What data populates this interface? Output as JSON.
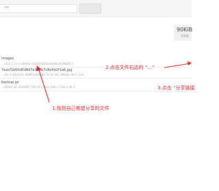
{
  "toolbar": {
    "search_value": "",
    "button_label": "",
    "left_text": "…oo"
  },
  "quota": {
    "size": "90KiB",
    "label": "总容量"
  },
  "items": [
    {
      "name": "images",
      "meta": "…r4e3 2 31 e-a4fe0a e3b2054b4ea0e48c0fa9b66(?)"
    },
    {
      "name": "7eacf1b5fc6fd8d7e1a5b7c8e4d2f1a6.jpg",
      "meta": "…r4e 3-d3e2c5a 4bf8f1a8e9d6c7b 2d 3b1 9f6a6a 4cf 1 2e3"
    },
    {
      "name": "backup.gz",
      "meta": "…a6de4 a6 3ee0d62 7b9 e6 2 3ad 1a6e 2 2ab e 4b 3"
    }
  ],
  "annotations": {
    "step1": "1.找到自己希望分享的文件",
    "step2": "2.点击文件右边的 “...”",
    "step3": "3.点击 “分享链接"
  },
  "colors": {
    "annotation": "#d9252a"
  }
}
